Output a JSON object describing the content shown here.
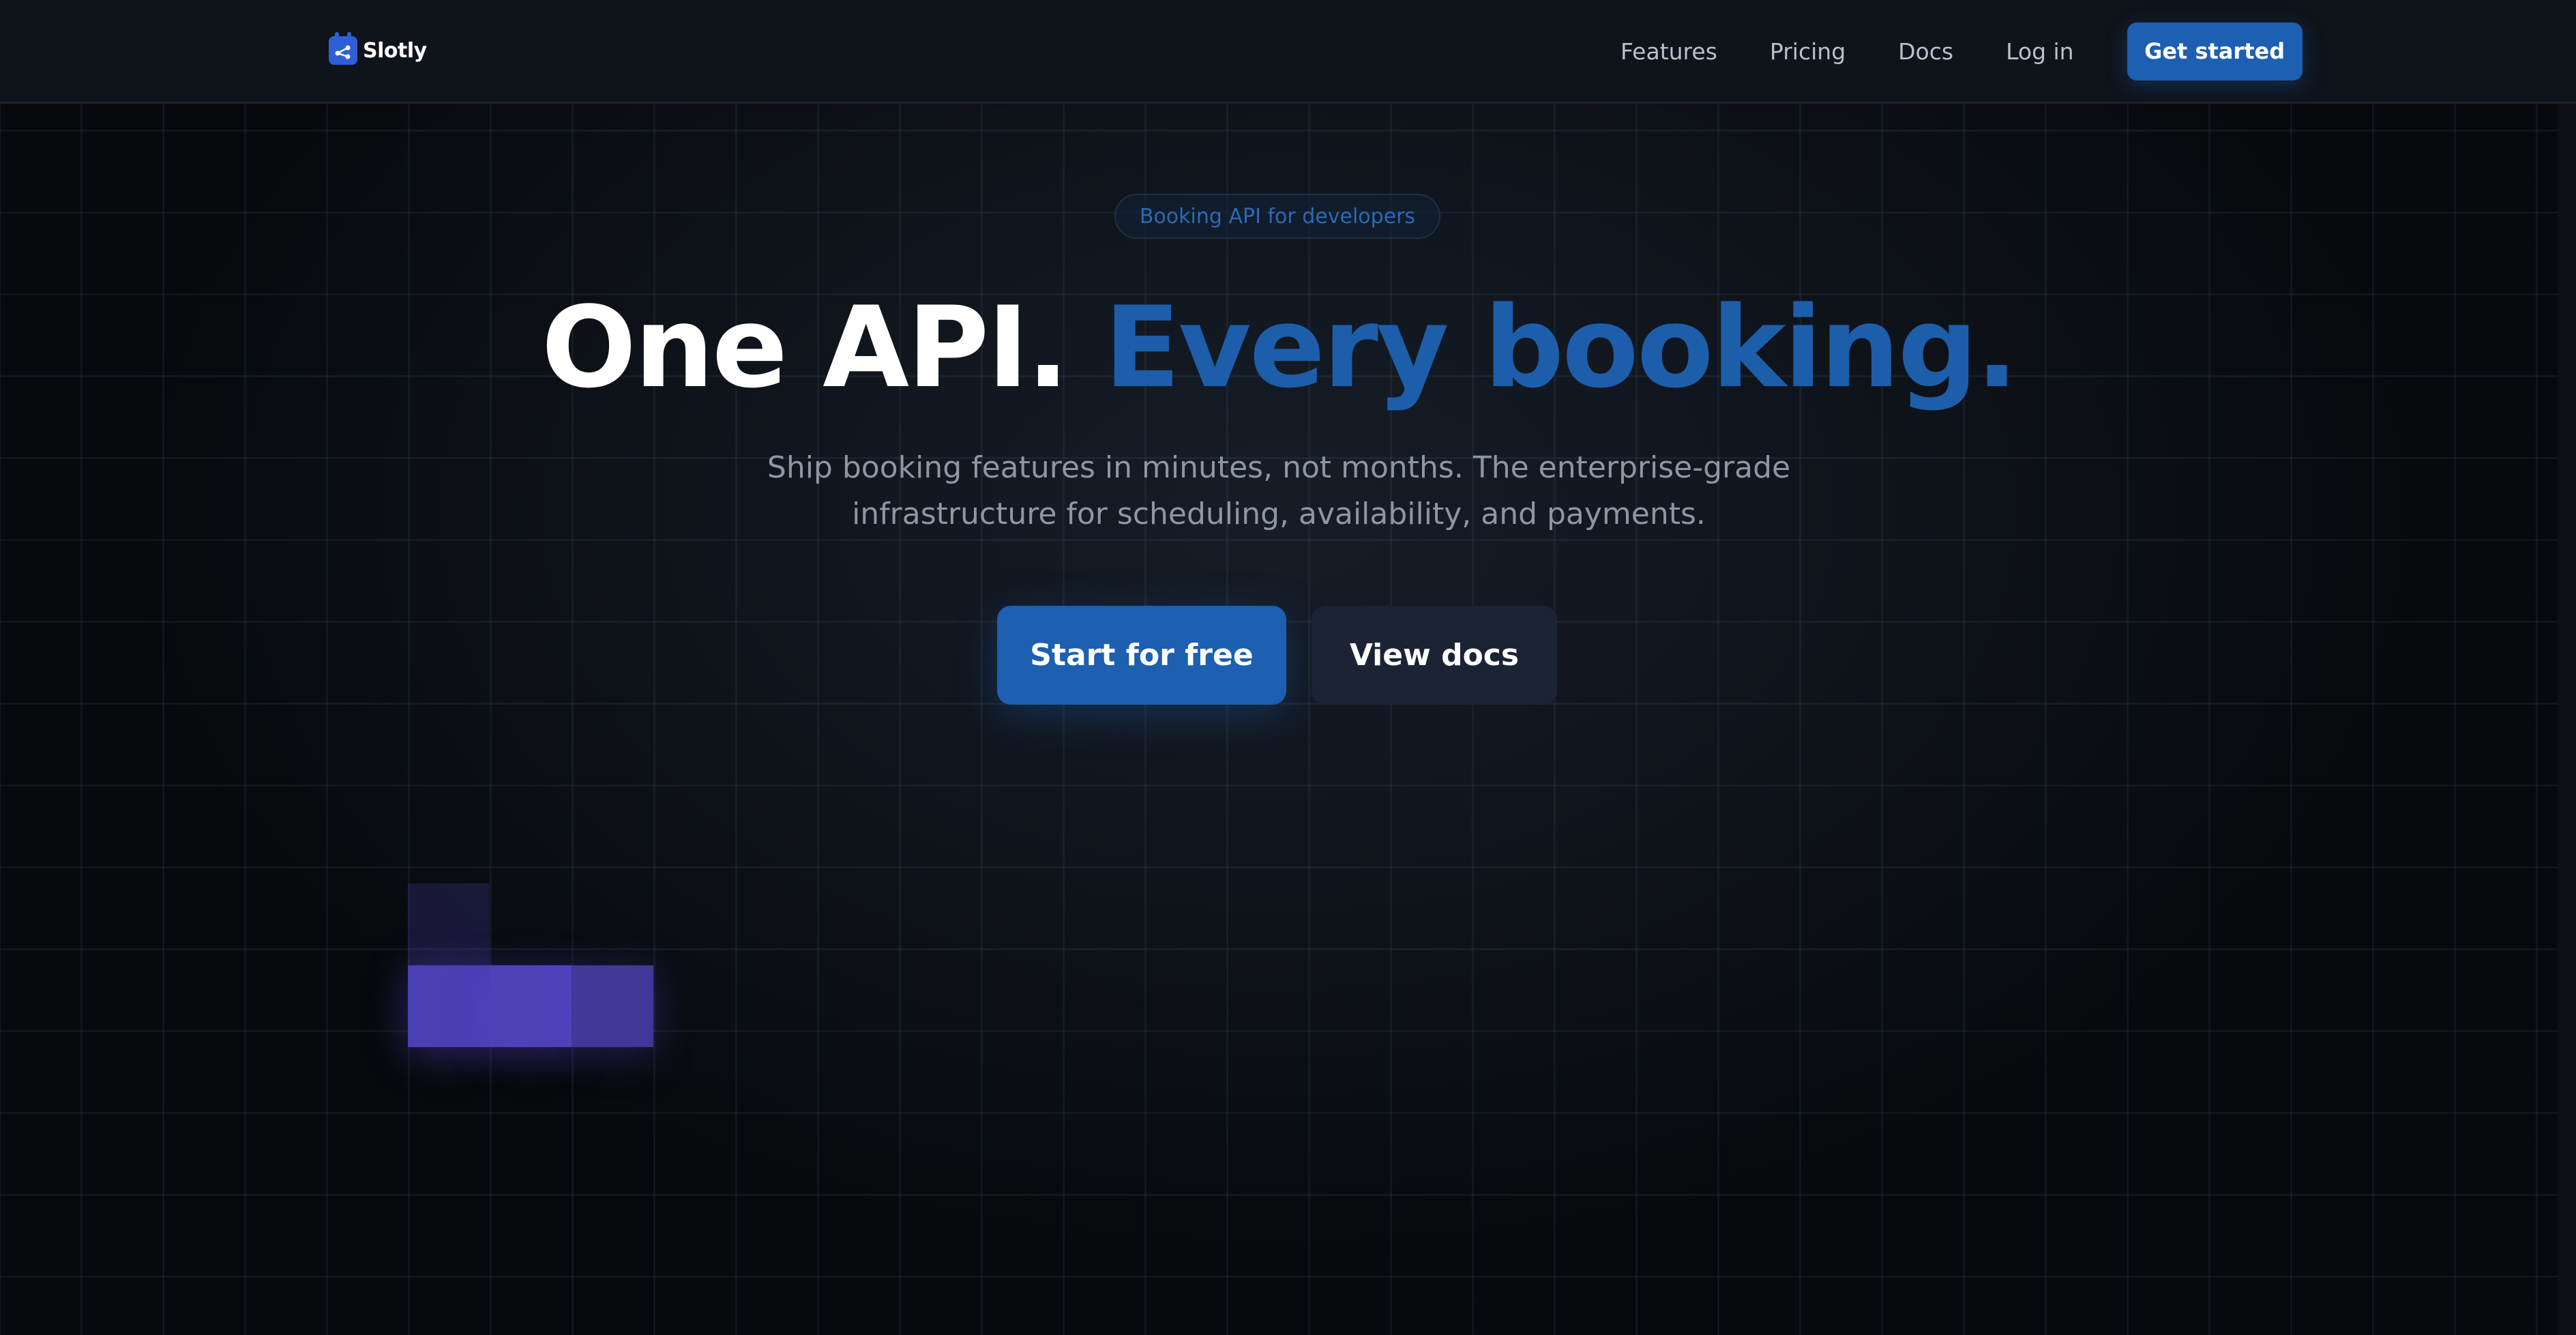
{
  "brand": {
    "name": "Slotly",
    "logo_icon": "calendar-share-icon",
    "accent": "#1d5fb0"
  },
  "nav": {
    "links": [
      "Features",
      "Pricing",
      "Docs",
      "Log in"
    ],
    "cta_label": "Get started"
  },
  "hero": {
    "badge": "Booking API for developers",
    "headline_part1": "One API.",
    "headline_part2": "Every booking.",
    "subtitle_line1": "Ship booking features in minutes, not months. The enterprise-grade",
    "subtitle_line2": "infrastructure for scheduling, availability, and payments.",
    "primary_button": "Start for free",
    "secondary_button": "View docs"
  },
  "colors": {
    "background": "#0b0e13",
    "headline_accent": "#1d5eaa",
    "highlight_cells": "#4a3fb4"
  }
}
